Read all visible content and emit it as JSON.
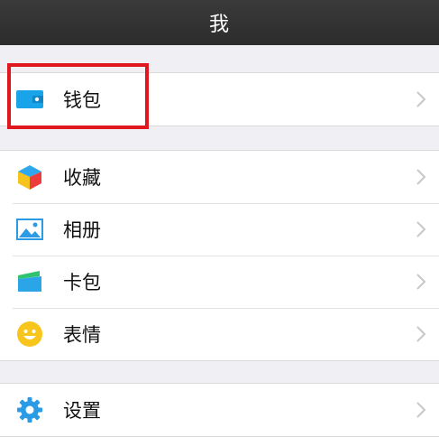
{
  "header": {
    "title": "我"
  },
  "groups": [
    {
      "items": [
        {
          "label": "钱包",
          "icon": "wallet-icon"
        }
      ]
    },
    {
      "items": [
        {
          "label": "收藏",
          "icon": "favorites-cube-icon"
        },
        {
          "label": "相册",
          "icon": "album-picture-icon"
        },
        {
          "label": "卡包",
          "icon": "card-wallet-icon"
        },
        {
          "label": "表情",
          "icon": "smiley-face-icon"
        }
      ]
    },
    {
      "items": [
        {
          "label": "设置",
          "icon": "gear-icon"
        }
      ]
    }
  ],
  "colors": {
    "navbar": "#2f2f2f",
    "background": "#efeff4",
    "highlight": "#e0171f",
    "wallet_blue": "#19a3e8"
  },
  "annotation": {
    "type": "red-highlight-box",
    "target": "钱包"
  }
}
